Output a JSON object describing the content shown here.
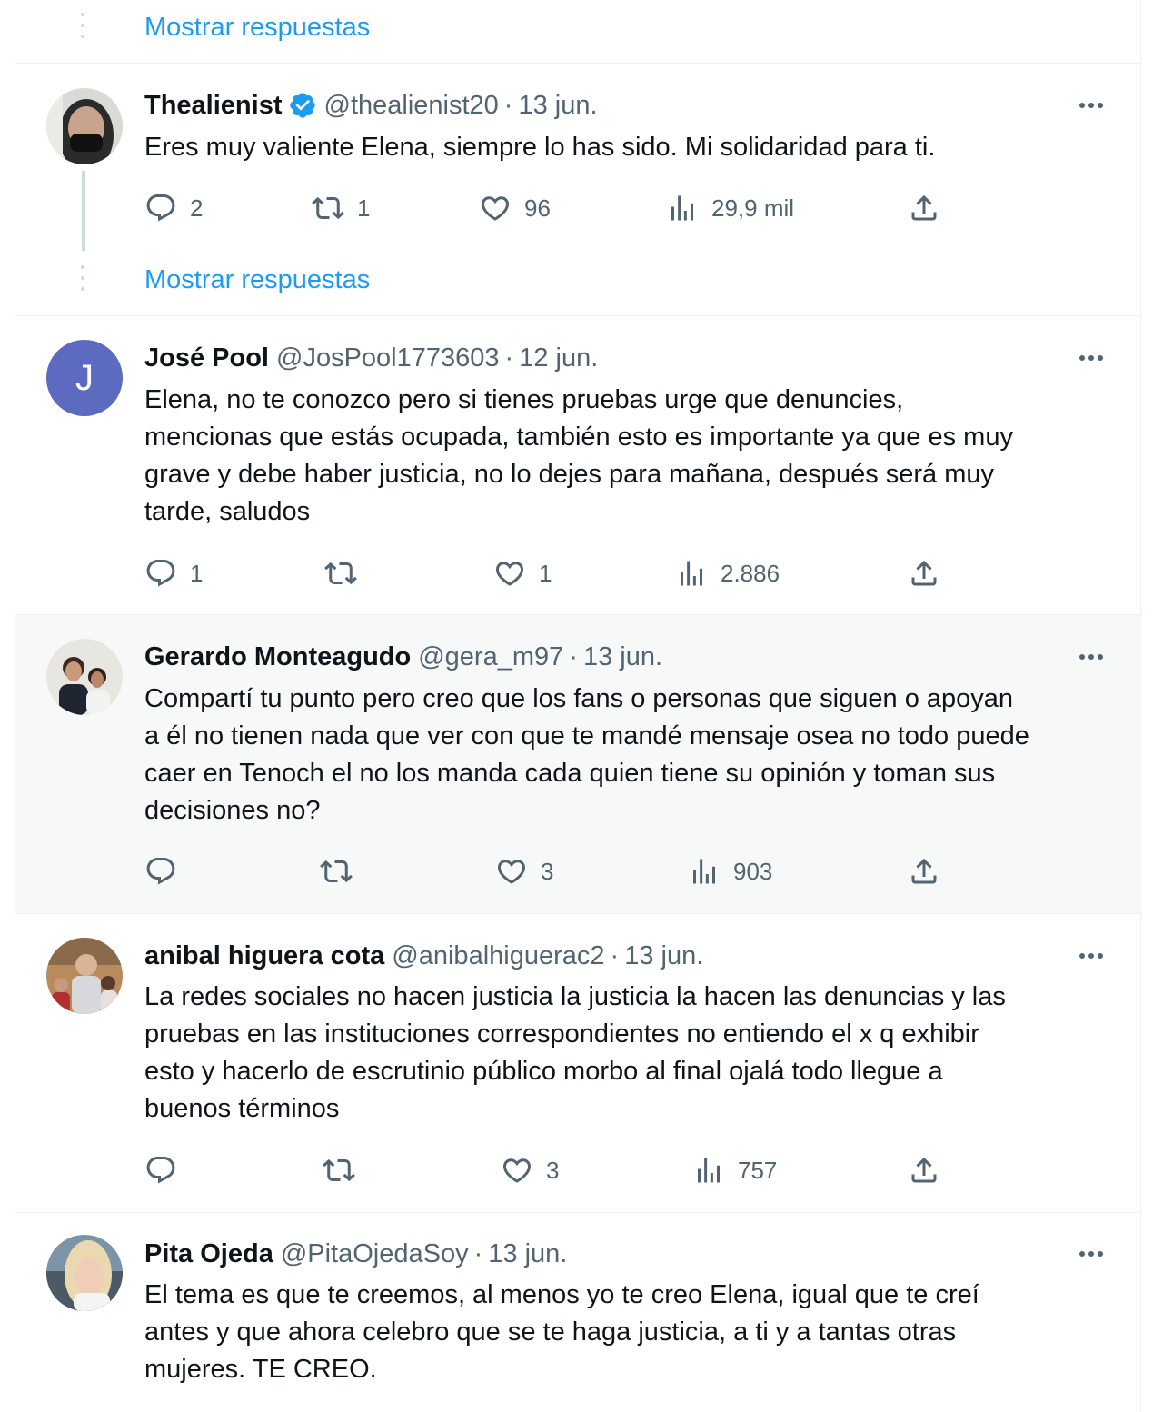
{
  "show_replies_label": "Mostrar respuestas",
  "tweets": [
    {
      "name": "Thealienist",
      "verified": true,
      "handle": "@thealienist20",
      "sep": "·",
      "date": "13 jun.",
      "text": "Eres muy valiente Elena, siempre lo has sido. Mi solidaridad para ti.",
      "replies": "2",
      "retweets": "1",
      "likes": "96",
      "views": "29,9 mil"
    },
    {
      "name": "José Pool",
      "avatar_letter": "J",
      "handle": "@JosPool1773603",
      "sep": "·",
      "date": "12 jun.",
      "text_lines": [
        "Elena, no te conozco pero si tienes pruebas urge que denuncies,",
        "mencionas que estás ocupada, también esto es importante ya que es muy",
        "grave y debe haber justicia, no lo dejes para mañana, después será muy",
        "tarde, saludos"
      ],
      "replies": "1",
      "retweets": "",
      "likes": "1",
      "views": "2.886"
    },
    {
      "name": "Gerardo Monteagudo",
      "handle": "@gera_m97",
      "sep": "·",
      "date": "13 jun.",
      "text_lines": [
        "Compartí tu punto pero creo que los fans o personas que siguen o apoyan",
        "a él no tienen nada que ver con que te mandé mensaje osea no todo puede",
        "caer en Tenoch el no los manda cada quien tiene su opinión y toman sus",
        "decisiones no?"
      ],
      "replies": "",
      "retweets": "",
      "likes": "3",
      "views": "903"
    },
    {
      "name": "anibal higuera cota",
      "handle": "@anibalhiguerac2",
      "sep": "·",
      "date": "13 jun.",
      "text_lines": [
        "La redes sociales no hacen justicia la justicia la hacen las denuncias y las",
        "pruebas en las instituciones correspondientes no entiendo el x q exhibir",
        "esto y hacerlo de escrutinio público morbo al final ojalá todo llegue a",
        "buenos términos"
      ],
      "replies": "",
      "retweets": "",
      "likes": "3",
      "views": "757"
    },
    {
      "name": "Pita Ojeda",
      "handle": "@PitaOjedaSoy",
      "sep": "·",
      "date": "13 jun.",
      "text_lines": [
        "El tema es que te creemos, al menos yo te creo Elena, igual que te creí",
        "antes y que ahora celebro que se te haga justicia, a ti y a tantas otras",
        "mujeres. TE CREO."
      ]
    }
  ],
  "colors": {
    "link": "#1d9bf0",
    "muted": "#536471",
    "text": "#0f1419",
    "verified": "#1d9bf0",
    "hover_bg": "#f7f9f9"
  },
  "icons": [
    "reply-icon",
    "retweet-icon",
    "like-icon",
    "views-icon",
    "share-icon",
    "more-icon",
    "verified-badge-icon"
  ]
}
